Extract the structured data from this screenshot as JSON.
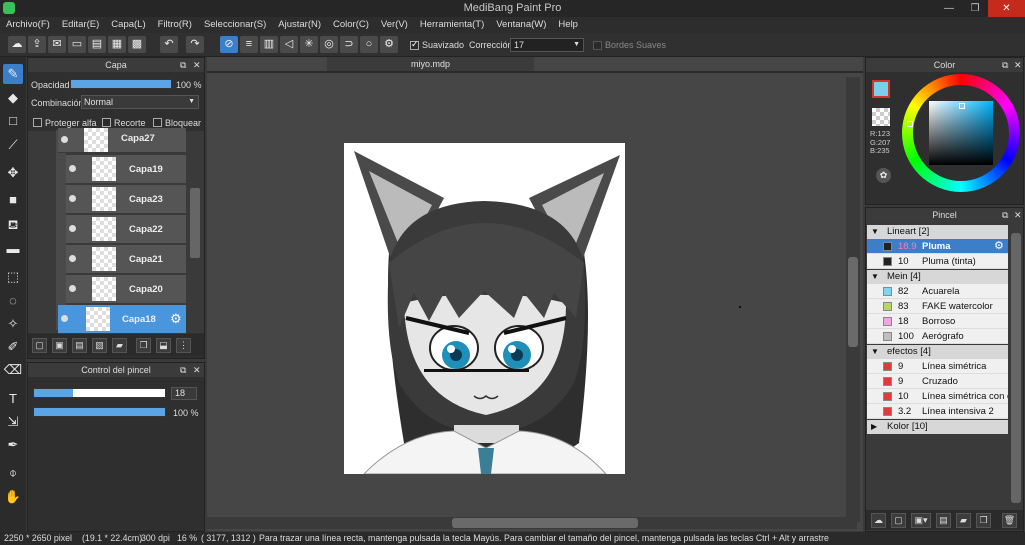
{
  "window": {
    "title": "MediBang Paint Pro"
  },
  "menu": [
    "Archivo(F)",
    "Editar(E)",
    "Capa(L)",
    "Filtro(R)",
    "Seleccionar(S)",
    "Ajustar(N)",
    "Color(C)",
    "Ver(V)",
    "Herramienta(T)",
    "Ventana(W)",
    "Help"
  ],
  "toolbar": {
    "smoothing_label": "Suavizado",
    "correction_label": "Corrección",
    "correction_value": "17",
    "soft_edges_label": "Bordes Suaves"
  },
  "layer_panel": {
    "title": "Capa",
    "opacity_label": "Opacidad",
    "opacity_value": "100 %",
    "opacity_level": 1.0,
    "blend_label": "Combinación",
    "blend_value": "Normal",
    "protect_alpha": "Proteger alfa",
    "clip": "Recorte",
    "lock": "Bloquear",
    "layers": [
      "Capa27",
      "Capa19",
      "Capa23",
      "Capa22",
      "Capa21",
      "Capa20",
      "Capa18"
    ],
    "selected_layer": "Capa18"
  },
  "brush_control": {
    "title": "Control del pincel",
    "size_value": "18",
    "opacity_value": "100 %",
    "size_level": 0.3,
    "opacity_level": 1.0
  },
  "canvas": {
    "tab_title": "miyo.mdp"
  },
  "color_panel": {
    "title": "Color",
    "r": "R:123",
    "g": "G:207",
    "b": "B:235",
    "current_color": "#7bcfeb"
  },
  "brush_panel": {
    "title": "Pincel",
    "folders": [
      {
        "name": "Lineart [2]",
        "items": [
          {
            "size": "18.9",
            "name": "Pluma",
            "color": "#222222"
          },
          {
            "size": "10",
            "name": "Pluma (tinta)",
            "color": "#222222"
          }
        ]
      },
      {
        "name": "Mein [4]",
        "items": [
          {
            "size": "82",
            "name": "Acuarela",
            "color": "#7fd4f0"
          },
          {
            "size": "83",
            "name": "FAKE watercolor",
            "color": "#b9d36a"
          },
          {
            "size": "18",
            "name": "Borroso",
            "color": "#f0a4e4"
          },
          {
            "size": "100",
            "name": "Aerógrafo",
            "color": "#bfbfbf"
          }
        ]
      },
      {
        "name": "efectos [4]",
        "items": [
          {
            "size": "9",
            "name": "Línea simétrica",
            "color": "#e03b3b"
          },
          {
            "size": "9",
            "name": "Cruzado",
            "color": "#e03b3b"
          },
          {
            "size": "10",
            "name": "Línea simétrica con cu",
            "color": "#e03b3b"
          },
          {
            "size": "3.2",
            "name": "Línea intensiva 2",
            "color": "#e03b3b"
          }
        ]
      },
      {
        "name": "Kolor [10]",
        "items": []
      }
    ]
  },
  "status": {
    "dimensions": "2250 * 2650 pixel",
    "physical": "(19.1 * 22.4cm)",
    "dpi": "300 dpi",
    "zoom": "16 %",
    "coords": "( 3177, 1312 )",
    "hint": "Para trazar una línea recta, mantenga pulsada la tecla Mayús. Para cambiar el tamaño del pincel, mantenga pulsada las teclas Ctrl + Alt y arrastre"
  }
}
